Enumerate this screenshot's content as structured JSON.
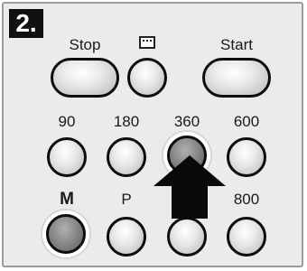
{
  "step_number": "2.",
  "row1": {
    "stop_label": "Stop",
    "grill_icon": "grill-icon",
    "start_label": "Start"
  },
  "row2": {
    "labels": [
      "90",
      "180",
      "360",
      "600"
    ]
  },
  "row3": {
    "labels": [
      "M",
      "P",
      "",
      "800"
    ]
  },
  "pressed_buttons": [
    "360",
    "M"
  ],
  "pointer": "down-arrow-icon"
}
